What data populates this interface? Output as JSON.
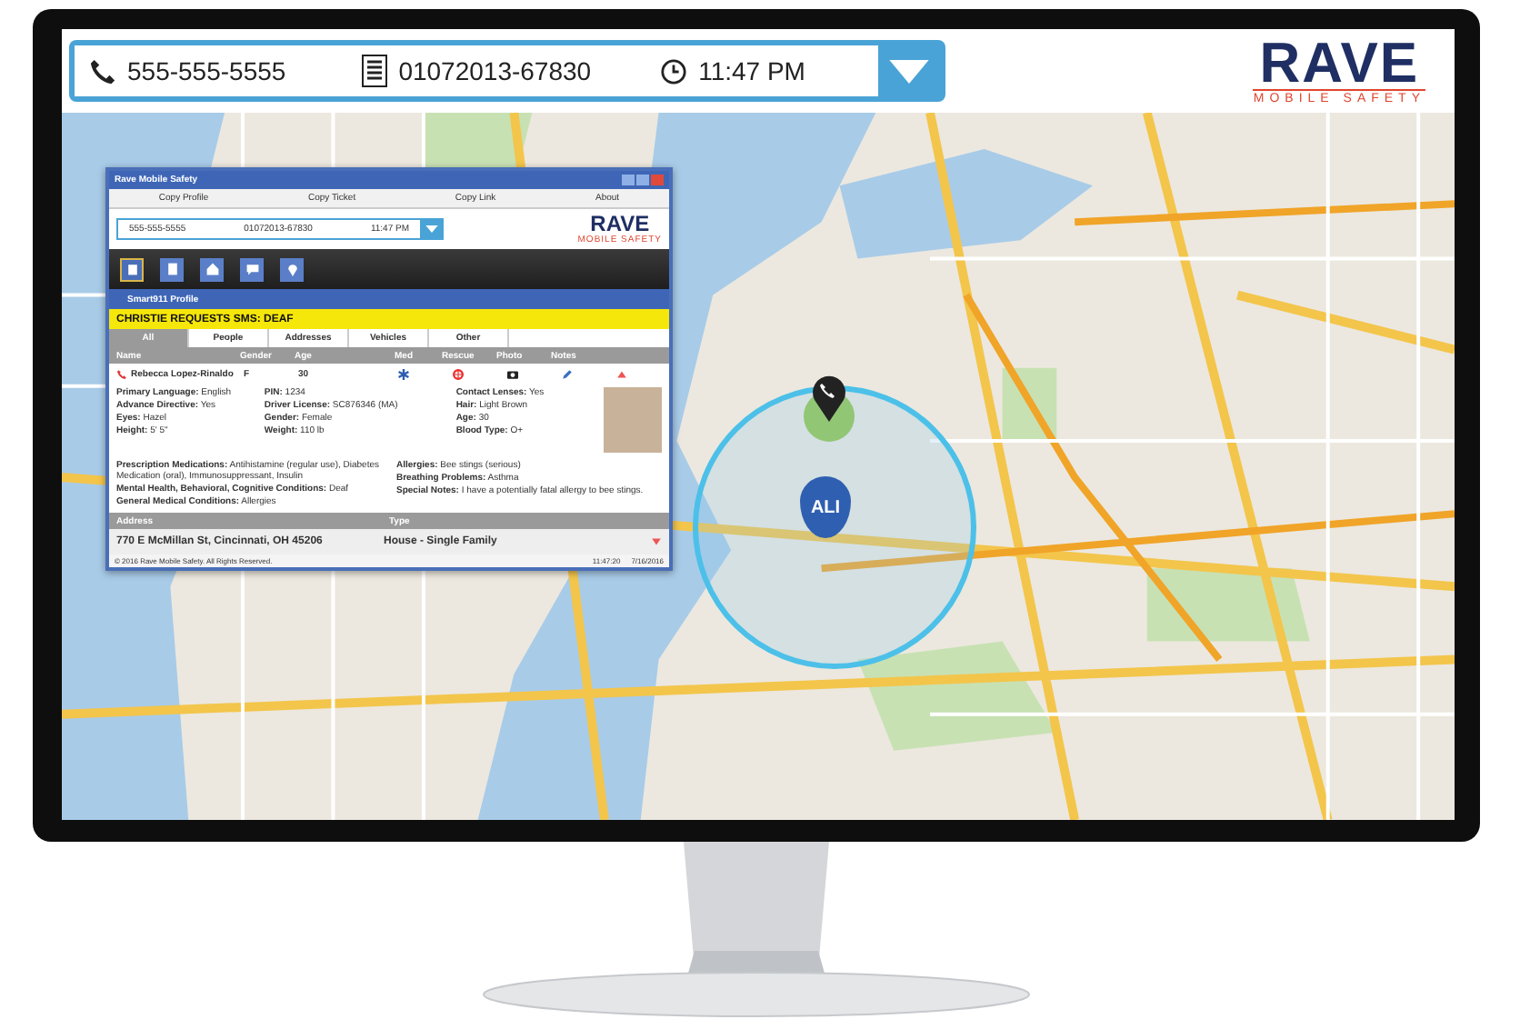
{
  "header": {
    "phone": "555-555-5555",
    "ticket": "01072013-67830",
    "time": "11:47 PM"
  },
  "logo": {
    "name": "RAVE",
    "tagline": "MOBILE SAFETY"
  },
  "map": {
    "pin_label": "ALI"
  },
  "app_window": {
    "title": "Rave Mobile Safety",
    "toolbar": [
      "Copy Profile",
      "Copy Ticket",
      "Copy Link",
      "About"
    ],
    "header": {
      "phone": "555-555-5555",
      "ticket": "01072013-67830",
      "time": "11:47 PM"
    },
    "logo": {
      "name": "RAVE",
      "tagline": "MOBILE SAFETY"
    },
    "nav_icons": [
      {
        "kind": "profile",
        "selected": true
      },
      {
        "kind": "document",
        "selected": false
      },
      {
        "kind": "home",
        "selected": false
      },
      {
        "kind": "chat",
        "selected": false
      },
      {
        "kind": "pin",
        "selected": false
      }
    ],
    "profile_title": "Smart911 Profile",
    "alert": "CHRISTIE REQUESTS SMS: DEAF",
    "tabs": [
      {
        "label": "All",
        "selected": true
      },
      {
        "label": "People",
        "selected": false
      },
      {
        "label": "Addresses",
        "selected": false
      },
      {
        "label": "Vehicles",
        "selected": false
      },
      {
        "label": "Other",
        "selected": false
      }
    ],
    "columns": [
      "Name",
      "Gender",
      "Age",
      "Med",
      "Rescue",
      "Photo",
      "Notes"
    ],
    "person": {
      "name": "Rebecca Lopez-Rinaldo",
      "gender": "F",
      "age": "30",
      "details_left": [
        "**Primary Language:** English",
        "**Advance Directive:** Yes",
        "**Eyes:** Hazel",
        "**Height:** 5' 5\""
      ],
      "details_middle": [
        "**PIN:** 1234",
        "**Driver License:** SC876346 (MA)",
        "**Gender:** Female",
        "**Weight:** 110 lb"
      ],
      "details_right": [
        "**Contact Lenses:** Yes",
        "**Hair:** Light Brown",
        "**Age:** 30",
        "**Blood Type:** O+"
      ],
      "notes_left": [
        "**Prescription Medications:** Antihistamine (regular use), Diabetes Medication (oral), Immunosuppressant, Insulin",
        "**Mental Health, Behavioral, Cognitive Conditions:** Deaf",
        "**General Medical Conditions:** Allergies"
      ],
      "notes_right": [
        "**Allergies:** Bee stings (serious)",
        "**Breathing Problems:** Asthma",
        "**Special Notes:** I have a potentially fatal allergy to bee stings."
      ]
    },
    "address_columns": [
      "Address",
      "Type"
    ],
    "address": {
      "street": "770 E McMillan St, Cincinnati, OH 45206",
      "type": "House - Single Family"
    },
    "footer": {
      "copyright": "© 2016 Rave Mobile Safety. All Rights Reserved.",
      "time": "11:47:20",
      "date": "7/16/2016"
    }
  }
}
